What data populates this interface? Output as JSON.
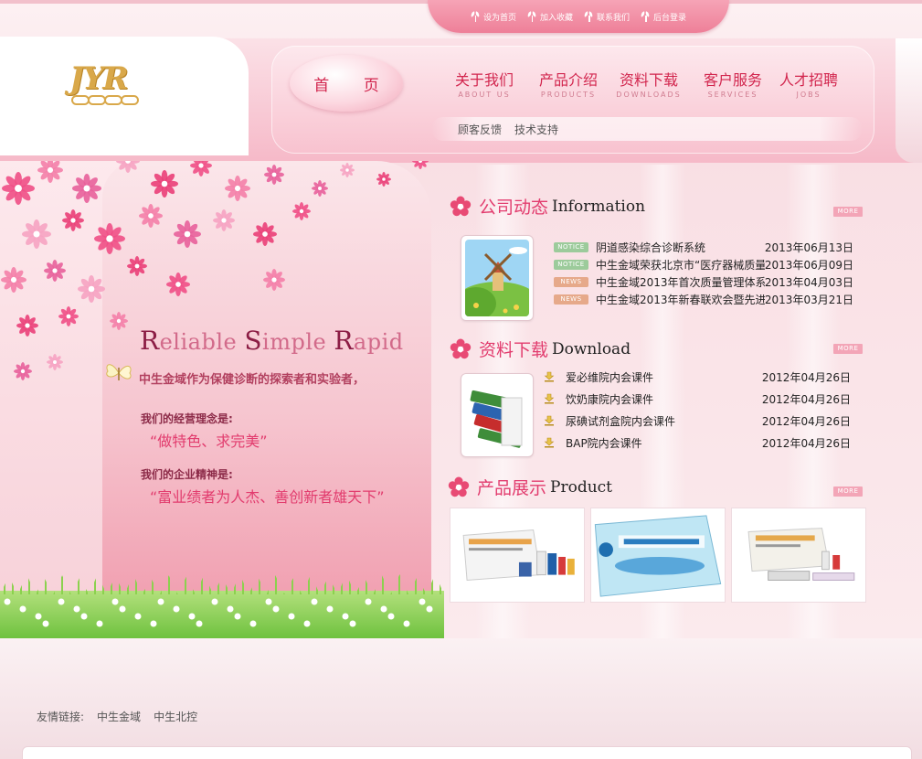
{
  "top_links": [
    {
      "label": "设为首页"
    },
    {
      "label": "加入收藏"
    },
    {
      "label": "联系我们"
    },
    {
      "label": "后台登录"
    }
  ],
  "logo": {
    "text": "JYR"
  },
  "nav": {
    "home": "首 页",
    "items": [
      {
        "zh": "关于我们",
        "en": "ABOUT US"
      },
      {
        "zh": "产品介绍",
        "en": "PRODUCTS"
      },
      {
        "zh": "资料下载",
        "en": "DOWNLOADS"
      },
      {
        "zh": "客户服务",
        "en": "SERVICES"
      },
      {
        "zh": "人才招聘",
        "en": "JOBS"
      }
    ],
    "sub": [
      "顾客反馈",
      "技术支持"
    ]
  },
  "hero": {
    "tagline": [
      {
        "cap": "R",
        "rest": "eliable "
      },
      {
        "cap": "S",
        "rest": "imple "
      },
      {
        "cap": "R",
        "rest": "apid"
      }
    ],
    "intro": "中生金域作为保健诊断的探索者和实验者，",
    "philosophy_label": "我们的经营理念是:",
    "philosophy": "“做特色、求完美”",
    "spirit_label": "我们的企业精神是:",
    "spirit": "“富业绩者为人杰、善创新者雄天下”"
  },
  "sections": {
    "news": {
      "zh": "公司动态",
      "en": "Information",
      "more": "MORE"
    },
    "download": {
      "zh": "资料下载",
      "en": "Download",
      "more": "MORE"
    },
    "product": {
      "zh": "产品展示",
      "en": "Product",
      "more": "MORE"
    }
  },
  "news": [
    {
      "badge": "NOTICE",
      "type": "notice",
      "title": "阴道感染综合诊断系统",
      "date": "2013年06月13日"
    },
    {
      "badge": "NOTICE",
      "type": "notice",
      "title": "中生金域荣获北京市“医疗器械质量",
      "date": "2013年06月09日"
    },
    {
      "badge": "NEWS",
      "type": "news",
      "title": "中生金域2013年首次质量管理体系工",
      "date": "2013年04月03日"
    },
    {
      "badge": "NEWS",
      "type": "news",
      "title": "中生金域2013年新春联欢会暨先进表",
      "date": "2013年03月21日"
    }
  ],
  "downloads": [
    {
      "title": "爱必维院内会课件",
      "date": "2012年04月26日"
    },
    {
      "title": "饮奶康院内会课件",
      "date": "2012年04月26日"
    },
    {
      "title": "尿碘试剂盒院内会课件",
      "date": "2012年04月26日"
    },
    {
      "title": "BAP院内会课件",
      "date": "2012年04月26日"
    }
  ],
  "products": [
    {
      "name": "product-kit-1"
    },
    {
      "name": "product-box-2"
    },
    {
      "name": "product-kit-3"
    }
  ],
  "friend_links": {
    "label": "友情链接:",
    "items": [
      "中生金域",
      "中生北控"
    ]
  },
  "colors": {
    "accent": "#e23c6e",
    "nav_text": "#d2264e",
    "pink_bg": "#f9dfe4"
  }
}
